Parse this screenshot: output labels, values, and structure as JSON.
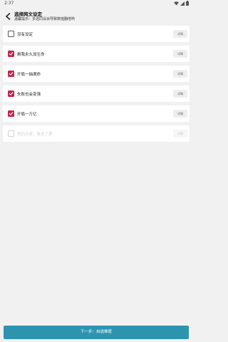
{
  "status_bar": {
    "time": "2:37"
  },
  "header": {
    "title": "选择网文设定",
    "subtitle": "温馨提示：多选同设会导致数值翻倍哟"
  },
  "options": [
    {
      "label": "没有设定",
      "checked": false,
      "disabled": false,
      "detail": "详情"
    },
    {
      "label": "剩我永久加生命",
      "checked": true,
      "disabled": false,
      "detail": "详情"
    },
    {
      "label": "开局一抽满命",
      "checked": true,
      "disabled": false,
      "detail": "详情"
    },
    {
      "label": "失败也会变强",
      "checked": true,
      "disabled": false,
      "detail": "详情"
    },
    {
      "label": "开局一万亿",
      "checked": true,
      "disabled": false,
      "detail": "详情"
    },
    {
      "label": "我的天赋，我说了算",
      "checked": false,
      "disabled": true,
      "detail": "详情"
    }
  ],
  "footer": {
    "next_label": "下一步：自选难度"
  },
  "colors": {
    "accent": "#c5264b",
    "primary_button": "#2d94b0"
  }
}
